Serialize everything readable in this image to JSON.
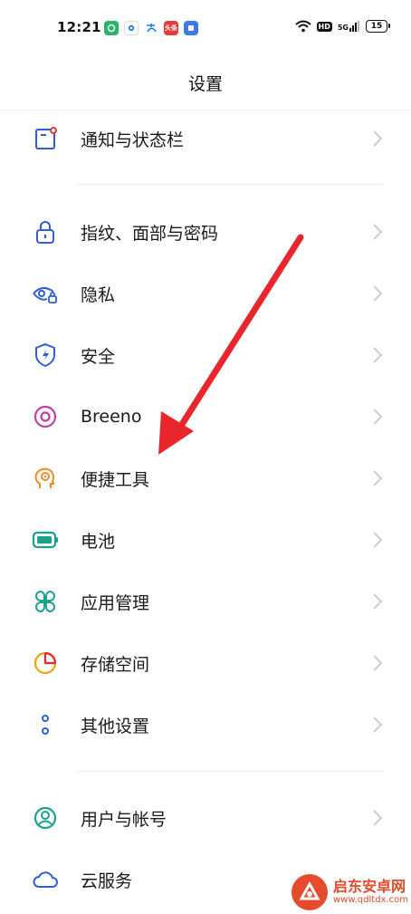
{
  "status_bar": {
    "time": "12:21",
    "network": "5G",
    "hd": "HD",
    "battery": "15",
    "notification_icons": [
      "wechat-icon",
      "app-icon",
      "alipay-icon",
      "toutiao-icon",
      "app-icon"
    ],
    "toutiao_text": "头条"
  },
  "header": {
    "title": "设置"
  },
  "settings": {
    "items": [
      {
        "label": "通知与状态栏",
        "icon": "notification-icon"
      },
      {
        "label": "指纹、面部与密码",
        "icon": "lock-icon"
      },
      {
        "label": "隐私",
        "icon": "privacy-eye-icon"
      },
      {
        "label": "安全",
        "icon": "shield-icon"
      },
      {
        "label": "Breeno",
        "icon": "breeno-icon"
      },
      {
        "label": "便捷工具",
        "icon": "head-icon"
      },
      {
        "label": "电池",
        "icon": "battery-icon"
      },
      {
        "label": "应用管理",
        "icon": "apps-icon"
      },
      {
        "label": "存储空间",
        "icon": "storage-icon"
      },
      {
        "label": "其他设置",
        "icon": "more-icon"
      },
      {
        "label": "用户与帐号",
        "icon": "user-icon"
      },
      {
        "label": "云服务",
        "icon": "cloud-icon"
      }
    ]
  },
  "watermark": {
    "title": "启东安卓网",
    "url": "www.qdltdx.com"
  },
  "colors": {
    "accent_blue": "#2f5ed8",
    "annotation_red": "#e8262c"
  }
}
